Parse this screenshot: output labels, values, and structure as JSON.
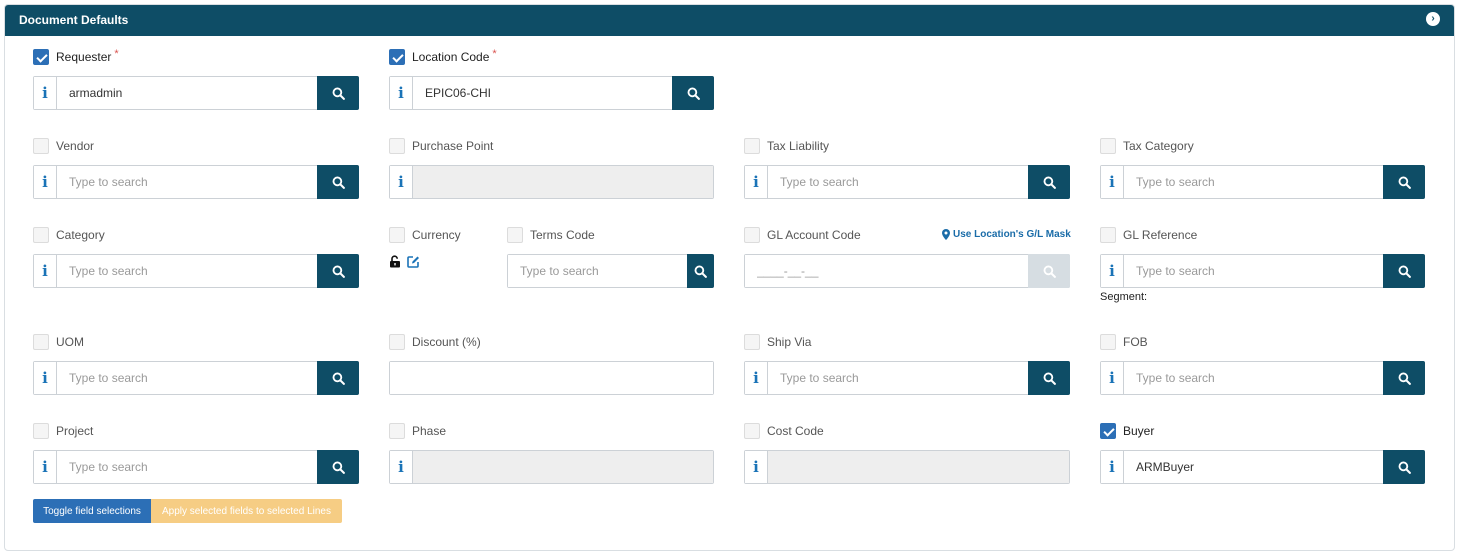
{
  "panel": {
    "title": "Document Defaults"
  },
  "fields": {
    "requester": {
      "label": "Requester",
      "required": "*",
      "value": "armadmin"
    },
    "location_code": {
      "label": "Location Code",
      "required": "*",
      "value": "EPIC06-CHI"
    },
    "vendor": {
      "label": "Vendor",
      "placeholder": "Type to search"
    },
    "purchase_point": {
      "label": "Purchase Point",
      "value": ""
    },
    "tax_liability": {
      "label": "Tax Liability",
      "placeholder": "Type to search"
    },
    "tax_category": {
      "label": "Tax Category",
      "placeholder": "Type to search"
    },
    "category": {
      "label": "Category",
      "placeholder": "Type to search"
    },
    "currency": {
      "label": "Currency"
    },
    "terms_code": {
      "label": "Terms Code",
      "placeholder": "Type to search"
    },
    "gl_account_code": {
      "label": "GL Account Code",
      "placeholder": "____-__-__",
      "mask_link": "Use Location's G/L Mask"
    },
    "gl_reference": {
      "label": "GL Reference",
      "placeholder": "Type to search",
      "segment_label": "Segment:"
    },
    "uom": {
      "label": "UOM",
      "placeholder": "Type to search"
    },
    "discount": {
      "label": "Discount (%)",
      "value": ""
    },
    "ship_via": {
      "label": "Ship Via",
      "placeholder": "Type to search"
    },
    "fob": {
      "label": "FOB",
      "placeholder": "Type to search"
    },
    "project": {
      "label": "Project",
      "placeholder": "Type to search"
    },
    "phase": {
      "label": "Phase",
      "value": ""
    },
    "cost_code": {
      "label": "Cost Code",
      "value": ""
    },
    "buyer": {
      "label": "Buyer",
      "value": "ARMBuyer"
    }
  },
  "info_glyph": "i",
  "buttons": {
    "toggle": "Toggle field selections",
    "apply": "Apply selected fields to selected Lines"
  },
  "colors": {
    "header": "#0e4d66",
    "primary": "#2c6fb6",
    "warning_disabled": "#f6cd84",
    "required": "#d9534f"
  }
}
